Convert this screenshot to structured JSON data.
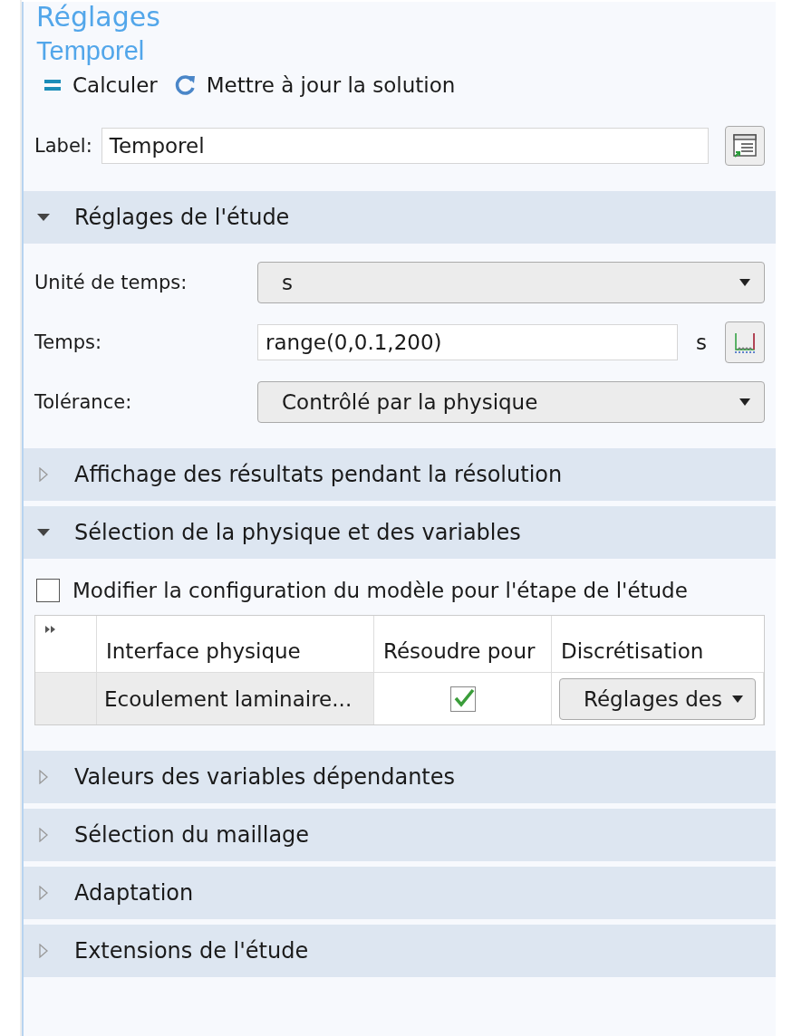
{
  "title": "Réglages",
  "subtitle": "Temporel",
  "toolbar": [
    {
      "kind": "compute",
      "label": "Calculer"
    },
    {
      "kind": "update",
      "label": "Mettre à jour la solution"
    }
  ],
  "label_field": {
    "label": "Label:",
    "value": "Temporel"
  },
  "sections": [
    {
      "title": "Réglages de l'étude",
      "expanded": true,
      "fields": [
        {
          "kind": "select",
          "label": "Unité de temps:",
          "value": "s"
        },
        {
          "kind": "input",
          "label": "Temps:",
          "value": "range(0,0.1,200)",
          "unit": "s"
        },
        {
          "kind": "select",
          "label": "Tolérance:",
          "value": "Contrôlé par la physique"
        }
      ]
    },
    {
      "title": "Affichage des résultats pendant la résolution",
      "expanded": false
    },
    {
      "title": "Sélection de la physique et des variables",
      "expanded": true,
      "checkbox": {
        "label": "Modifier la configuration du modèle pour l'étape de l'étude",
        "checked": false
      },
      "table": {
        "columns": [
          "Interface physique",
          "Résoudre pour",
          "Discrétisation"
        ],
        "rows": [
          {
            "interface": "Ecoulement laminaire...",
            "solve": true,
            "discretization": "Réglages des"
          }
        ]
      }
    },
    {
      "title": "Valeurs des variables dépendantes",
      "expanded": false
    },
    {
      "title": "Sélection du maillage",
      "expanded": false
    },
    {
      "title": "Adaptation",
      "expanded": false
    },
    {
      "title": "Extensions de l'étude",
      "expanded": false
    }
  ]
}
